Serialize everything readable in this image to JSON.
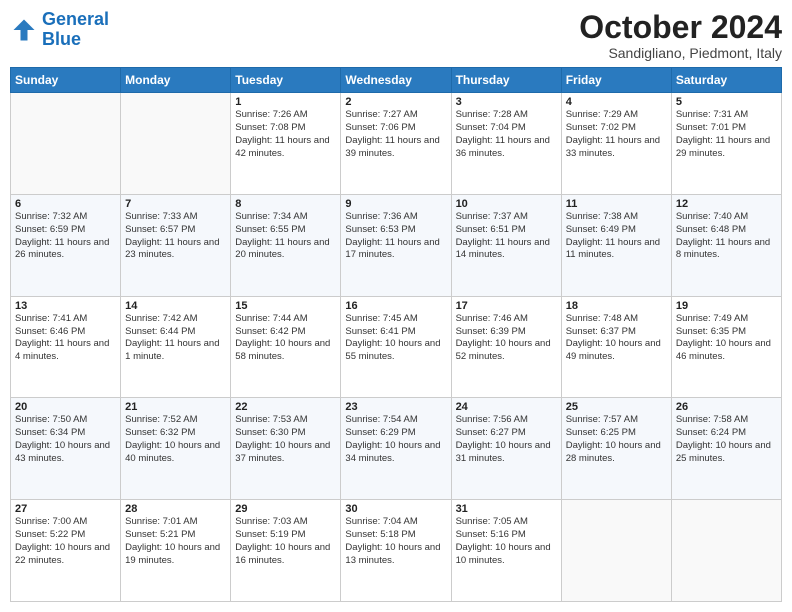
{
  "header": {
    "logo_line1": "General",
    "logo_line2": "Blue",
    "month": "October 2024",
    "location": "Sandigliano, Piedmont, Italy"
  },
  "weekdays": [
    "Sunday",
    "Monday",
    "Tuesday",
    "Wednesday",
    "Thursday",
    "Friday",
    "Saturday"
  ],
  "weeks": [
    [
      null,
      null,
      {
        "day": 1,
        "sunrise": "7:26 AM",
        "sunset": "7:08 PM",
        "daylight": "11 hours and 42 minutes."
      },
      {
        "day": 2,
        "sunrise": "7:27 AM",
        "sunset": "7:06 PM",
        "daylight": "11 hours and 39 minutes."
      },
      {
        "day": 3,
        "sunrise": "7:28 AM",
        "sunset": "7:04 PM",
        "daylight": "11 hours and 36 minutes."
      },
      {
        "day": 4,
        "sunrise": "7:29 AM",
        "sunset": "7:02 PM",
        "daylight": "11 hours and 33 minutes."
      },
      {
        "day": 5,
        "sunrise": "7:31 AM",
        "sunset": "7:01 PM",
        "daylight": "11 hours and 29 minutes."
      }
    ],
    [
      {
        "day": 6,
        "sunrise": "7:32 AM",
        "sunset": "6:59 PM",
        "daylight": "11 hours and 26 minutes."
      },
      {
        "day": 7,
        "sunrise": "7:33 AM",
        "sunset": "6:57 PM",
        "daylight": "11 hours and 23 minutes."
      },
      {
        "day": 8,
        "sunrise": "7:34 AM",
        "sunset": "6:55 PM",
        "daylight": "11 hours and 20 minutes."
      },
      {
        "day": 9,
        "sunrise": "7:36 AM",
        "sunset": "6:53 PM",
        "daylight": "11 hours and 17 minutes."
      },
      {
        "day": 10,
        "sunrise": "7:37 AM",
        "sunset": "6:51 PM",
        "daylight": "11 hours and 14 minutes."
      },
      {
        "day": 11,
        "sunrise": "7:38 AM",
        "sunset": "6:49 PM",
        "daylight": "11 hours and 11 minutes."
      },
      {
        "day": 12,
        "sunrise": "7:40 AM",
        "sunset": "6:48 PM",
        "daylight": "11 hours and 8 minutes."
      }
    ],
    [
      {
        "day": 13,
        "sunrise": "7:41 AM",
        "sunset": "6:46 PM",
        "daylight": "11 hours and 4 minutes."
      },
      {
        "day": 14,
        "sunrise": "7:42 AM",
        "sunset": "6:44 PM",
        "daylight": "11 hours and 1 minute."
      },
      {
        "day": 15,
        "sunrise": "7:44 AM",
        "sunset": "6:42 PM",
        "daylight": "10 hours and 58 minutes."
      },
      {
        "day": 16,
        "sunrise": "7:45 AM",
        "sunset": "6:41 PM",
        "daylight": "10 hours and 55 minutes."
      },
      {
        "day": 17,
        "sunrise": "7:46 AM",
        "sunset": "6:39 PM",
        "daylight": "10 hours and 52 minutes."
      },
      {
        "day": 18,
        "sunrise": "7:48 AM",
        "sunset": "6:37 PM",
        "daylight": "10 hours and 49 minutes."
      },
      {
        "day": 19,
        "sunrise": "7:49 AM",
        "sunset": "6:35 PM",
        "daylight": "10 hours and 46 minutes."
      }
    ],
    [
      {
        "day": 20,
        "sunrise": "7:50 AM",
        "sunset": "6:34 PM",
        "daylight": "10 hours and 43 minutes."
      },
      {
        "day": 21,
        "sunrise": "7:52 AM",
        "sunset": "6:32 PM",
        "daylight": "10 hours and 40 minutes."
      },
      {
        "day": 22,
        "sunrise": "7:53 AM",
        "sunset": "6:30 PM",
        "daylight": "10 hours and 37 minutes."
      },
      {
        "day": 23,
        "sunrise": "7:54 AM",
        "sunset": "6:29 PM",
        "daylight": "10 hours and 34 minutes."
      },
      {
        "day": 24,
        "sunrise": "7:56 AM",
        "sunset": "6:27 PM",
        "daylight": "10 hours and 31 minutes."
      },
      {
        "day": 25,
        "sunrise": "7:57 AM",
        "sunset": "6:25 PM",
        "daylight": "10 hours and 28 minutes."
      },
      {
        "day": 26,
        "sunrise": "7:58 AM",
        "sunset": "6:24 PM",
        "daylight": "10 hours and 25 minutes."
      }
    ],
    [
      {
        "day": 27,
        "sunrise": "7:00 AM",
        "sunset": "5:22 PM",
        "daylight": "10 hours and 22 minutes."
      },
      {
        "day": 28,
        "sunrise": "7:01 AM",
        "sunset": "5:21 PM",
        "daylight": "10 hours and 19 minutes."
      },
      {
        "day": 29,
        "sunrise": "7:03 AM",
        "sunset": "5:19 PM",
        "daylight": "10 hours and 16 minutes."
      },
      {
        "day": 30,
        "sunrise": "7:04 AM",
        "sunset": "5:18 PM",
        "daylight": "10 hours and 13 minutes."
      },
      {
        "day": 31,
        "sunrise": "7:05 AM",
        "sunset": "5:16 PM",
        "daylight": "10 hours and 10 minutes."
      },
      null,
      null
    ]
  ]
}
